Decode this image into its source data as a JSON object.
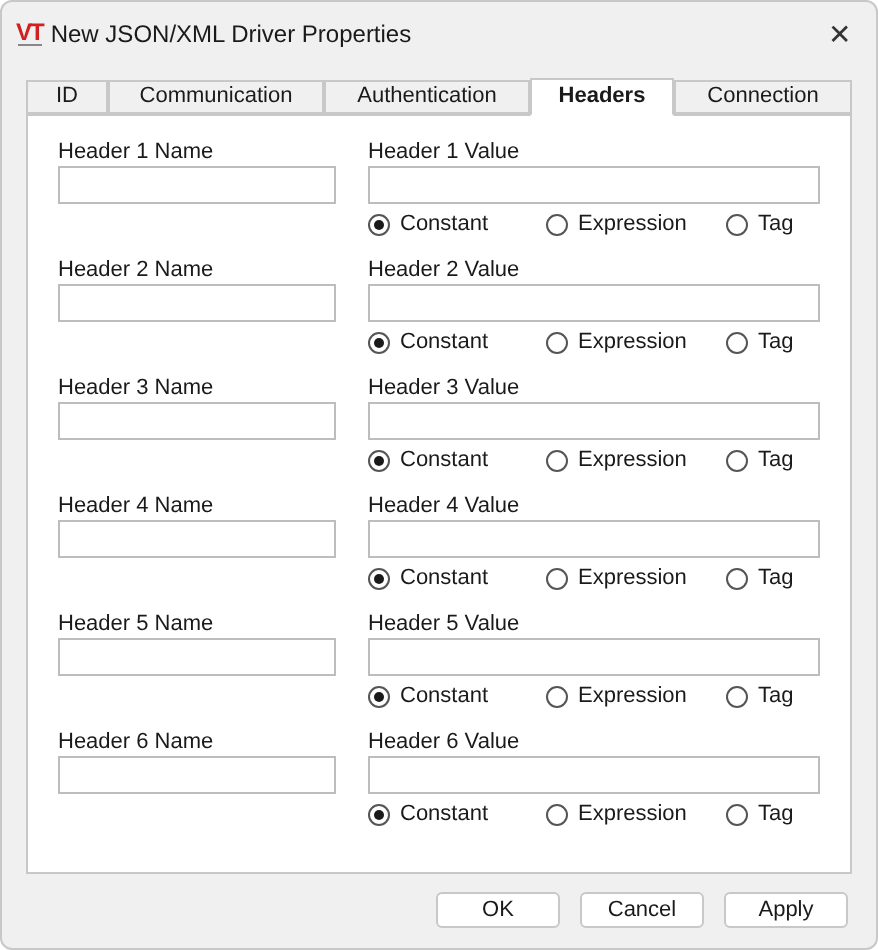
{
  "window": {
    "logo": "VT",
    "title": "New JSON/XML Driver Properties",
    "close": "✕"
  },
  "tabs": [
    {
      "label": "ID",
      "selected": false
    },
    {
      "label": "Communication",
      "selected": false
    },
    {
      "label": "Authentication",
      "selected": false
    },
    {
      "label": "Headers",
      "selected": true
    },
    {
      "label": "Connection",
      "selected": false
    }
  ],
  "headers": [
    {
      "name_label": "Header 1 Name",
      "value_label": "Header 1 Value",
      "options": [
        {
          "label": "Constant",
          "selected": true
        },
        {
          "label": "Expression",
          "selected": false
        },
        {
          "label": "Tag",
          "selected": false
        }
      ]
    },
    {
      "name_label": "Header 2 Name",
      "value_label": "Header 2 Value",
      "options": [
        {
          "label": "Constant",
          "selected": true
        },
        {
          "label": "Expression",
          "selected": false
        },
        {
          "label": "Tag",
          "selected": false
        }
      ]
    },
    {
      "name_label": "Header 3 Name",
      "value_label": "Header 3 Value",
      "options": [
        {
          "label": "Constant",
          "selected": true
        },
        {
          "label": "Expression",
          "selected": false
        },
        {
          "label": "Tag",
          "selected": false
        }
      ]
    },
    {
      "name_label": "Header 4 Name",
      "value_label": "Header 4 Value",
      "options": [
        {
          "label": "Constant",
          "selected": true
        },
        {
          "label": "Expression",
          "selected": false
        },
        {
          "label": "Tag",
          "selected": false
        }
      ]
    },
    {
      "name_label": "Header 5 Name",
      "value_label": "Header 5 Value",
      "options": [
        {
          "label": "Constant",
          "selected": true
        },
        {
          "label": "Expression",
          "selected": false
        },
        {
          "label": "Tag",
          "selected": false
        }
      ]
    },
    {
      "name_label": "Header 6 Name",
      "value_label": "Header 6 Value",
      "options": [
        {
          "label": "Constant",
          "selected": true
        },
        {
          "label": "Expression",
          "selected": false
        },
        {
          "label": "Tag",
          "selected": false
        }
      ]
    }
  ],
  "buttons": [
    "OK",
    "Cancel",
    "Apply"
  ]
}
